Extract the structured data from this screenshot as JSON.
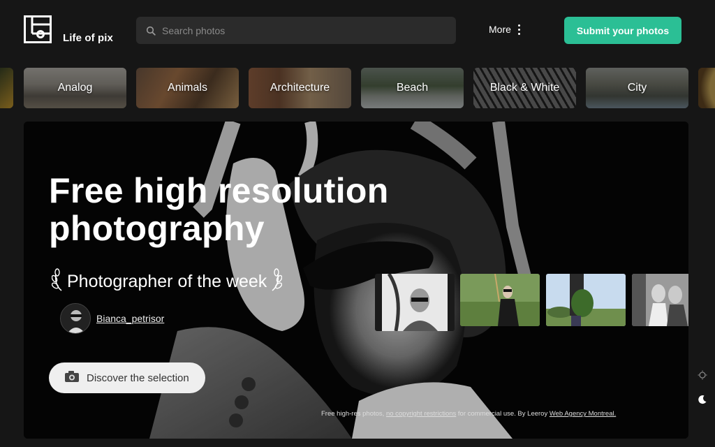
{
  "header": {
    "logo_text": "Life of pix",
    "search_placeholder": "Search photos",
    "more_label": "More",
    "submit_label": "Submit your photos"
  },
  "categories": [
    "Analog",
    "Animals",
    "Architecture",
    "Beach",
    "Black & White",
    "City"
  ],
  "hero": {
    "title": "Free high resolution photography",
    "potw_label": "Photographer of the week",
    "photographer_name": "Bianca_petrisor",
    "discover_label": "Discover the selection",
    "credit": {
      "prefix": "Free high-res photos, ",
      "link1": "no copyright restrictions",
      "middle": " for commercial use. By Leeroy ",
      "link2": "Web Agency Montreal."
    }
  },
  "colors": {
    "background": "#161616",
    "accent": "#2bbf95",
    "search_bg": "#2b2b2b"
  }
}
